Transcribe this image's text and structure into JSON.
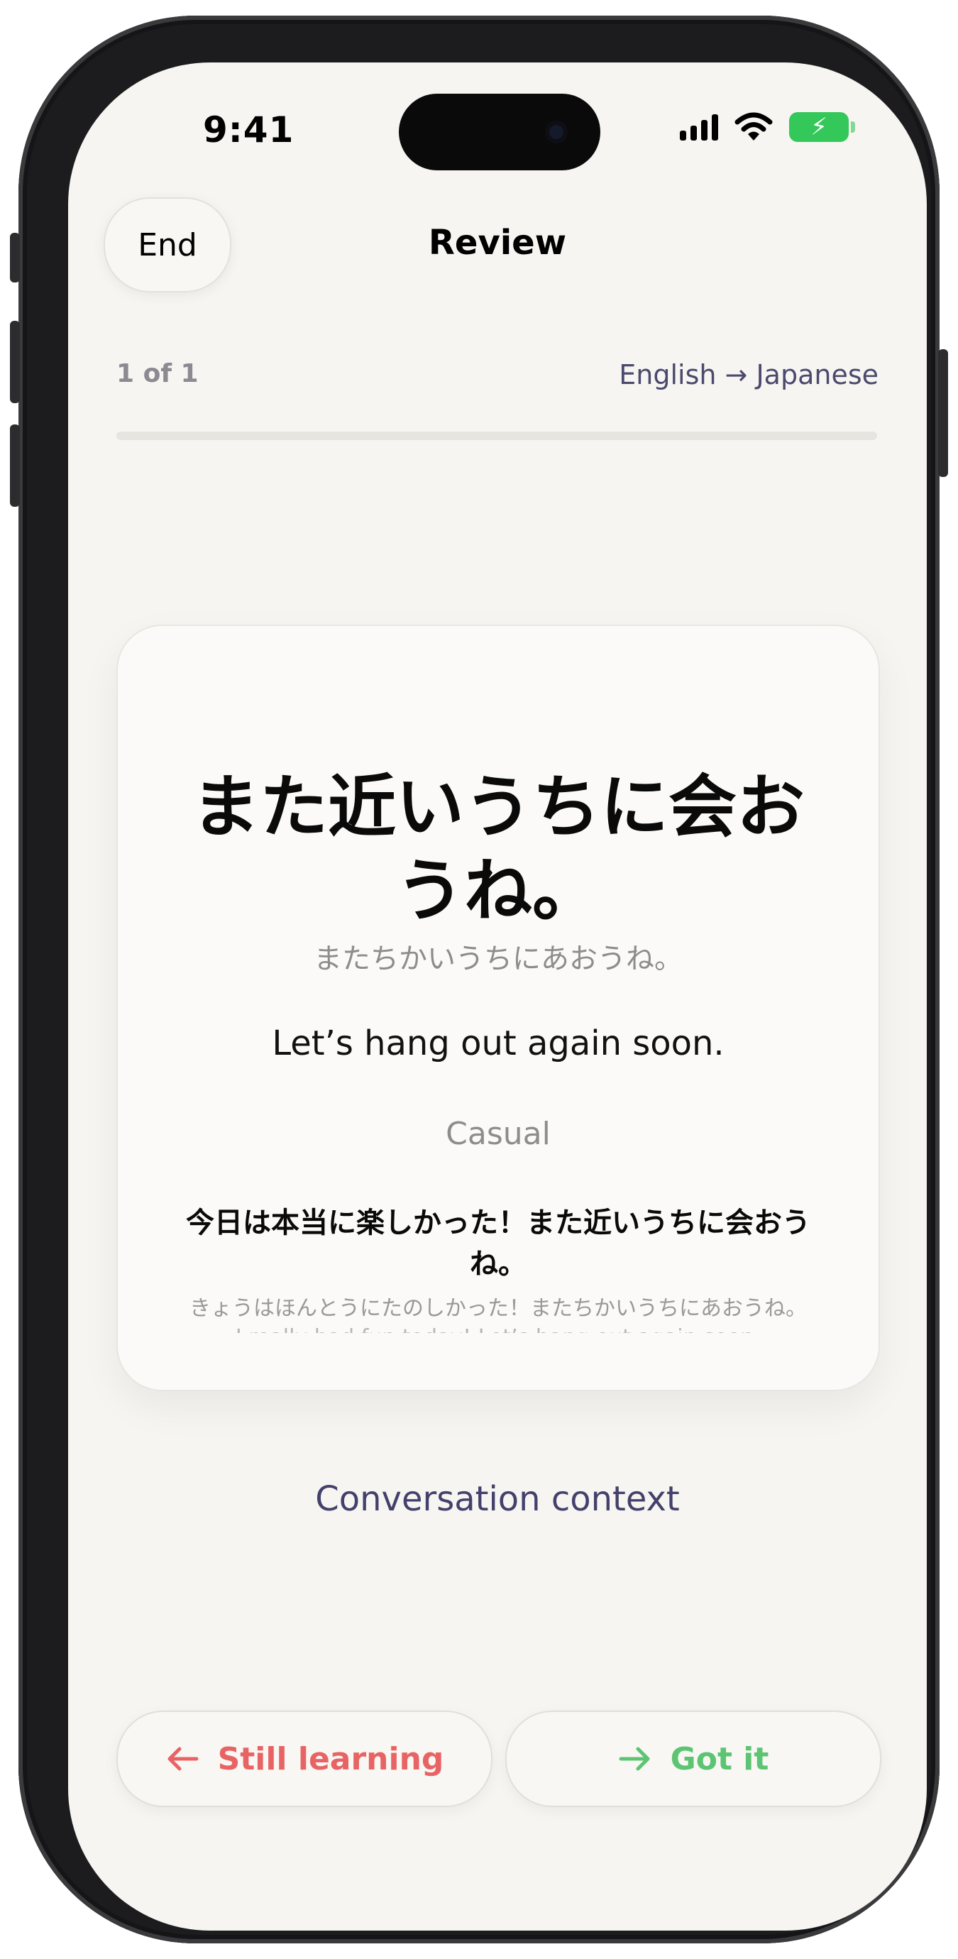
{
  "status_bar": {
    "time": "9:41",
    "icons": [
      "cellular-signal-icon",
      "wifi-icon",
      "battery-charging-icon"
    ]
  },
  "header": {
    "end_label": "End",
    "title": "Review"
  },
  "progress": {
    "counter": "1 of 1",
    "direction": "English → Japanese",
    "value": 0
  },
  "card": {
    "phrase": "また近いうちに会おうね。",
    "reading": "またちかいうちにあおうね。",
    "translation": "Let’s hang out again soon.",
    "register": "Casual",
    "example": "今日は本当に楽しかった！また近いうちに会おうね。",
    "example_reading": "きょうはほんとうにたのしかった！またちかいうちにあおうね。",
    "example_translation": "I really had fun today! Let’s hang out again soon."
  },
  "context_link": "Conversation context",
  "actions": {
    "still_learning": "Still learning",
    "got_it": "Got it"
  },
  "colors": {
    "background": "#f6f5f1",
    "accent_text": "#43416c",
    "still_learning": "#e86464",
    "got_it": "#5cc472",
    "battery": "#34c759"
  }
}
